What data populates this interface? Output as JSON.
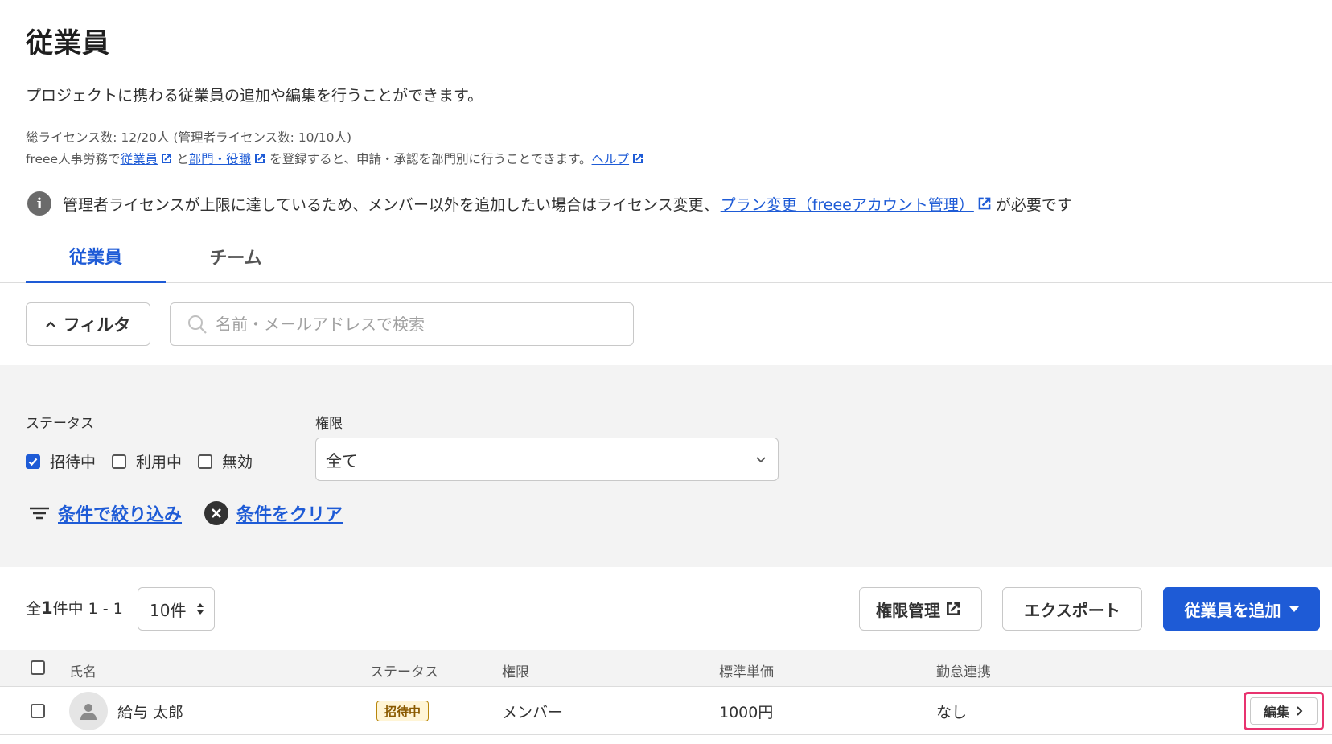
{
  "page": {
    "title": "従業員",
    "description": "プロジェクトに携わる従業員の追加や編集を行うことができます。",
    "license_info": "総ライセンス数: 12/20人 (管理者ライセンス数: 10/10人)"
  },
  "integration": {
    "prefix": "freee人事労務で",
    "link_employees": "従業員",
    "mid": "と",
    "link_dept": "部門・役職",
    "suffix": "を登録すると、申請・承認を部門別に行うことできます。",
    "link_help": "ヘルプ"
  },
  "notice": {
    "icon": "info-icon",
    "text_before": "管理者ライセンスが上限に達しているため、メンバー以外を追加したい場合はライセンス変更、",
    "link": "プラン変更（freeeアカウント管理）",
    "text_after": "が必要です"
  },
  "tabs": [
    {
      "label": "従業員",
      "active": true
    },
    {
      "label": "チーム",
      "active": false
    }
  ],
  "toolbar": {
    "filter_label": "フィルタ",
    "search_placeholder": "名前・メールアドレスで検索"
  },
  "filters": {
    "status_label": "ステータス",
    "status_options": [
      {
        "label": "招待中",
        "checked": true
      },
      {
        "label": "利用中",
        "checked": false
      },
      {
        "label": "無効",
        "checked": false
      }
    ],
    "role_label": "権限",
    "role_value": "全て",
    "apply_label": "条件で絞り込み",
    "clear_label": "条件をクリア"
  },
  "list": {
    "count_prefix": "全",
    "count_total": "1",
    "count_suffix": "件中 1 - 1",
    "per_page": "10件",
    "perm_button": "権限管理",
    "export_button": "エクスポート",
    "add_button": "従業員を追加"
  },
  "table": {
    "headers": [
      "氏名",
      "ステータス",
      "権限",
      "標準単価",
      "勤怠連携"
    ],
    "rows": [
      {
        "name": "給与 太郎",
        "status": "招待中",
        "role": "メンバー",
        "price": "1000円",
        "attendance": "なし",
        "edit": "編集"
      }
    ]
  },
  "colors": {
    "accent": "#1e5bd6",
    "highlight": "#e8336f",
    "badge": "#fff5d6"
  }
}
